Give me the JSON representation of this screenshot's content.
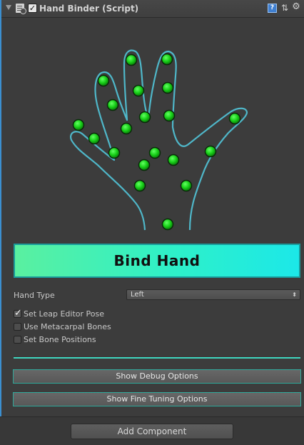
{
  "header": {
    "title": "Hand Binder (Script)",
    "enabled": true,
    "icons": [
      "foldout-arrow-icon",
      "script-icon",
      "help-icon",
      "preset-icon",
      "gear-icon"
    ]
  },
  "hand_diagram": {
    "outline_color": "#4fb7c9",
    "joint_color": "#1bd11b",
    "joint_count": 21
  },
  "bind_button": {
    "label": "Bind Hand"
  },
  "hand_type": {
    "label": "Hand Type",
    "value": "Left"
  },
  "options": {
    "set_leap_editor_pose": {
      "label": "Set Leap Editor Pose",
      "checked": true
    },
    "use_metacarpal_bones": {
      "label": "Use Metacarpal Bones",
      "checked": false
    },
    "set_bone_positions": {
      "label": "Set Bone Positions",
      "checked": false
    }
  },
  "buttons": {
    "show_debug": "Show Debug Options",
    "show_fine_tuning": "Show Fine Tuning Options"
  },
  "footer": {
    "add_component": "Add Component"
  },
  "colors": {
    "accent_teal": "#3fd6c0",
    "bind_gradient_start": "#5af0a0",
    "bind_gradient_end": "#1ce8e8",
    "panel_bg": "#3c3c3c",
    "selection_border": "#3b8fd0"
  }
}
